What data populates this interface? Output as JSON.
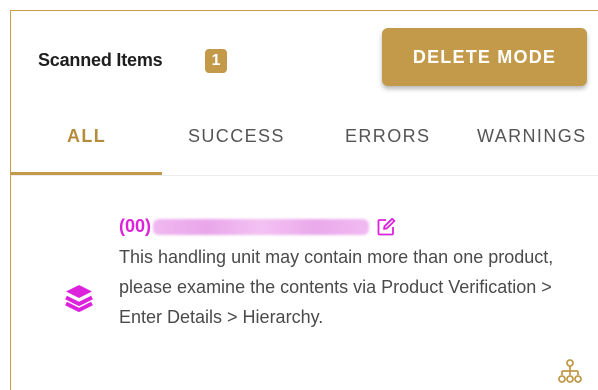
{
  "header": {
    "title": "Scanned Items",
    "count": "1",
    "delete_button_label": "DELETE MODE"
  },
  "tabs": [
    {
      "label": "ALL",
      "active": true
    },
    {
      "label": "SUCCESS",
      "active": false
    },
    {
      "label": "ERRORS",
      "active": false
    },
    {
      "label": "WARNINGS",
      "active": false
    }
  ],
  "items": [
    {
      "code_prefix": "(00)",
      "message": "This handling unit may contain more than one product, please examine the contents via Product Verification > Enter Details > Hierarchy.",
      "status_icon": "layers-icon"
    }
  ],
  "icons": {
    "edit": "edit-icon",
    "hierarchy": "hierarchy-icon",
    "status": "layers-icon"
  },
  "colors": {
    "accent": "#c29a4a",
    "accent_text": "#b58c3c",
    "warning_magenta": "#dd22dd",
    "text": "#4a4a4a"
  }
}
